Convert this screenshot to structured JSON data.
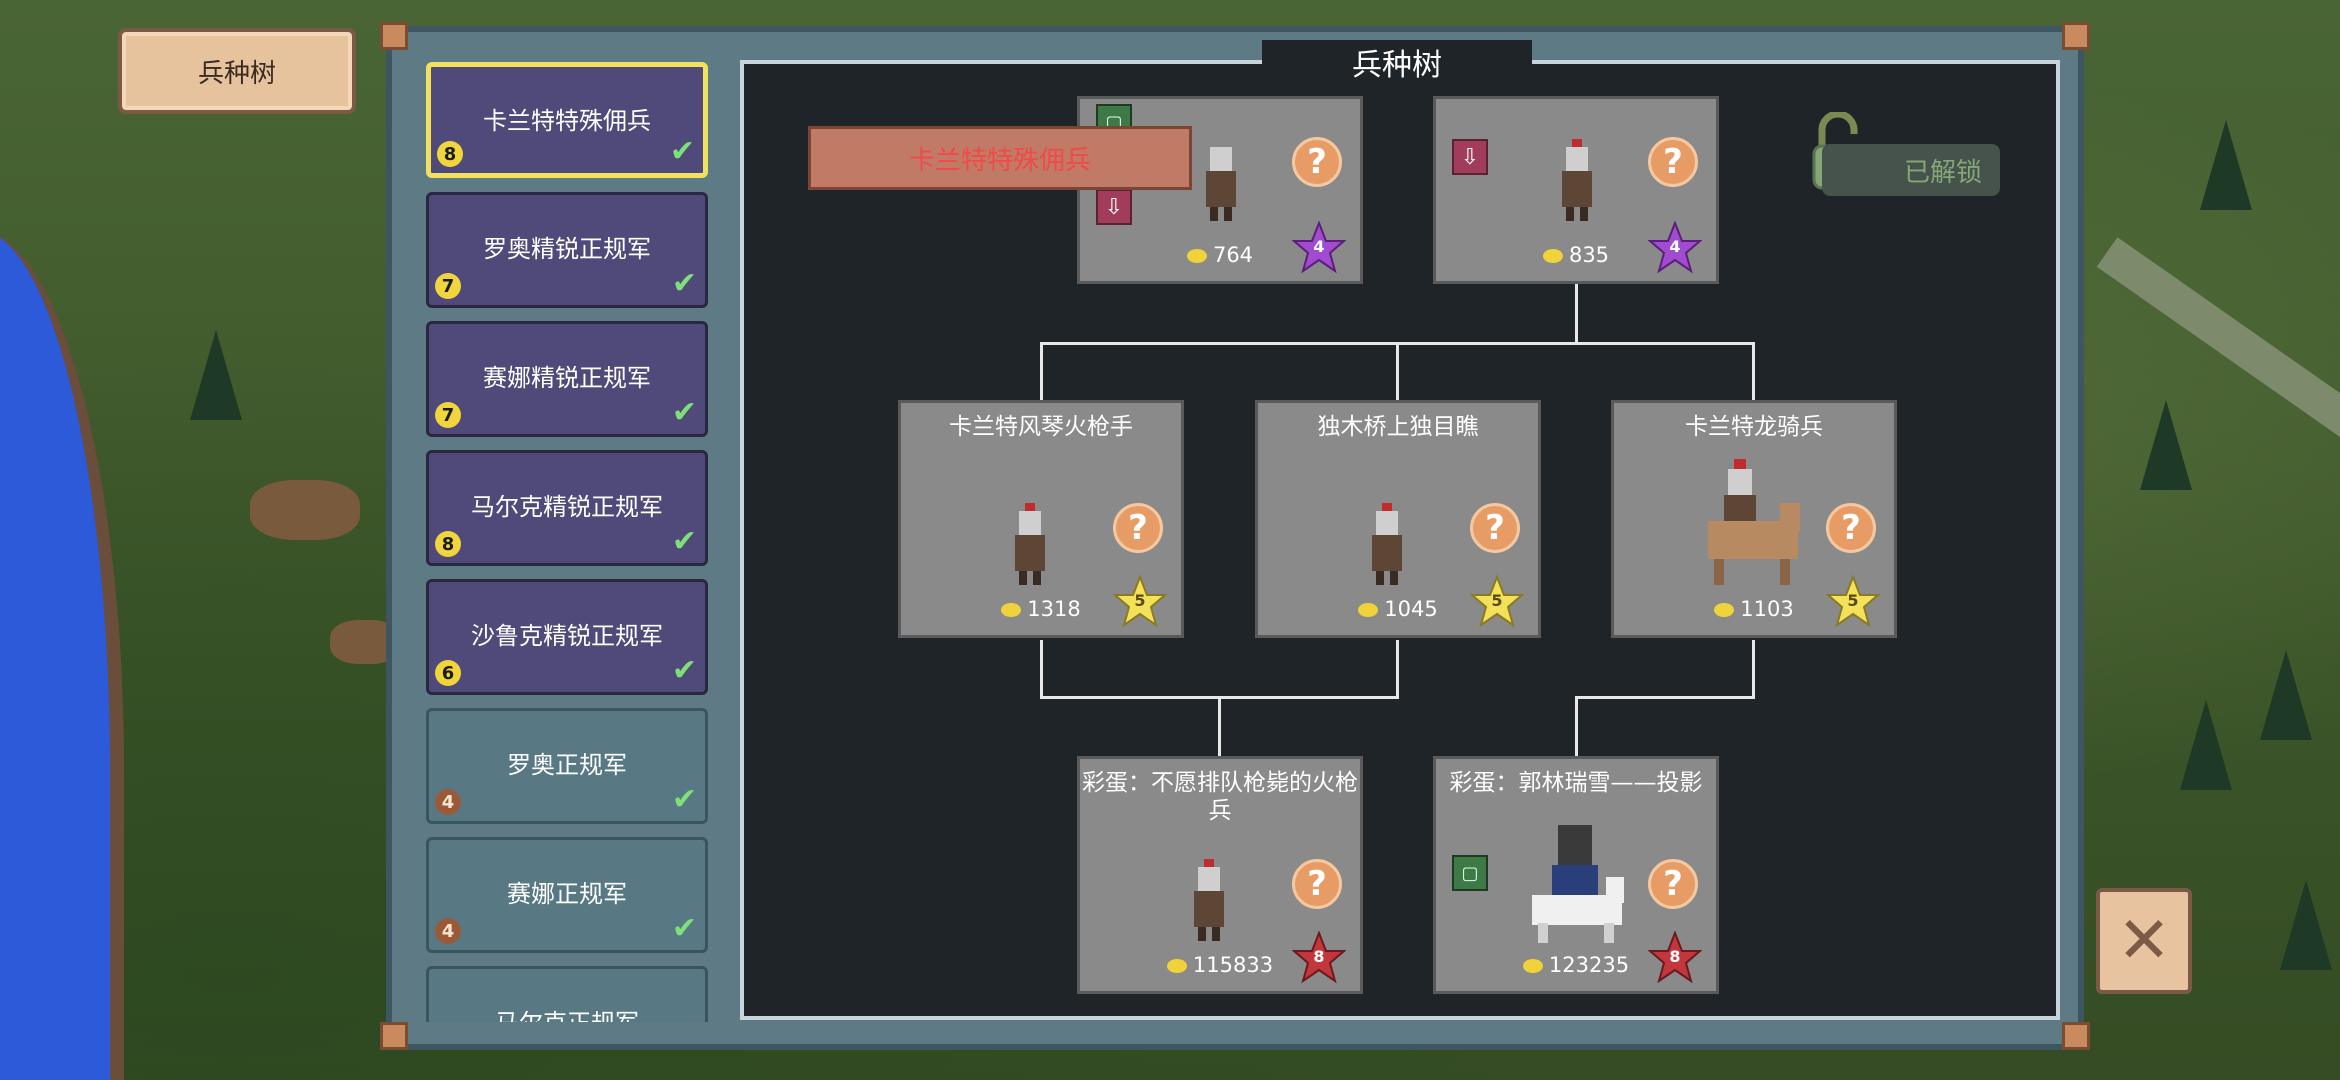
{
  "header": {
    "button_label": "兵种树"
  },
  "sidebar": {
    "items": [
      {
        "label": "卡兰特特殊佣兵",
        "tier": "8",
        "style": "elite",
        "selected": true
      },
      {
        "label": "罗奥精锐正规军",
        "tier": "7",
        "style": "elite"
      },
      {
        "label": "赛娜精锐正规军",
        "tier": "7",
        "style": "elite"
      },
      {
        "label": "马尔克精锐正规军",
        "tier": "8",
        "style": "elite"
      },
      {
        "label": "沙鲁克精锐正规军",
        "tier": "6",
        "style": "elite"
      },
      {
        "label": "罗奥正规军",
        "tier": "4",
        "style": "regular"
      },
      {
        "label": "赛娜正规军",
        "tier": "4",
        "style": "regular"
      },
      {
        "label": "马尔克正规军",
        "tier": "",
        "style": "regular"
      }
    ]
  },
  "panel": {
    "title": "兵种树",
    "selected_unit": "卡兰特特殊佣兵",
    "unlock_label": "已解锁"
  },
  "nodes": {
    "top_left": {
      "name": "",
      "cost": "764",
      "star": "4"
    },
    "top_right": {
      "name": "",
      "cost": "835",
      "star": "4"
    },
    "mid_left": {
      "name": "卡兰特风琴火枪手",
      "cost": "1318",
      "star": "5"
    },
    "mid_center": {
      "name": "独木桥上独目瞧",
      "cost": "1045",
      "star": "5"
    },
    "mid_right": {
      "name": "卡兰特龙骑兵",
      "cost": "1103",
      "star": "5"
    },
    "bottom_left": {
      "name": "彩蛋：不愿排队枪毙的火枪兵",
      "cost": "115833",
      "star": "8"
    },
    "bottom_right": {
      "name": "彩蛋：郭林瑞雪——投影",
      "cost": "123235",
      "star": "8"
    }
  },
  "colors": {
    "star_purple": "#a14bd0",
    "star_gold": "#f3e15a",
    "star_red": "#c3363c",
    "accent_selected": "#f0e15e"
  },
  "icons": {
    "help": "question-mark-icon",
    "coin": "coin-icon",
    "close": "close-icon",
    "lock": "unlock-icon",
    "down": "down-arrow-icon"
  },
  "close_symbol": "✕"
}
